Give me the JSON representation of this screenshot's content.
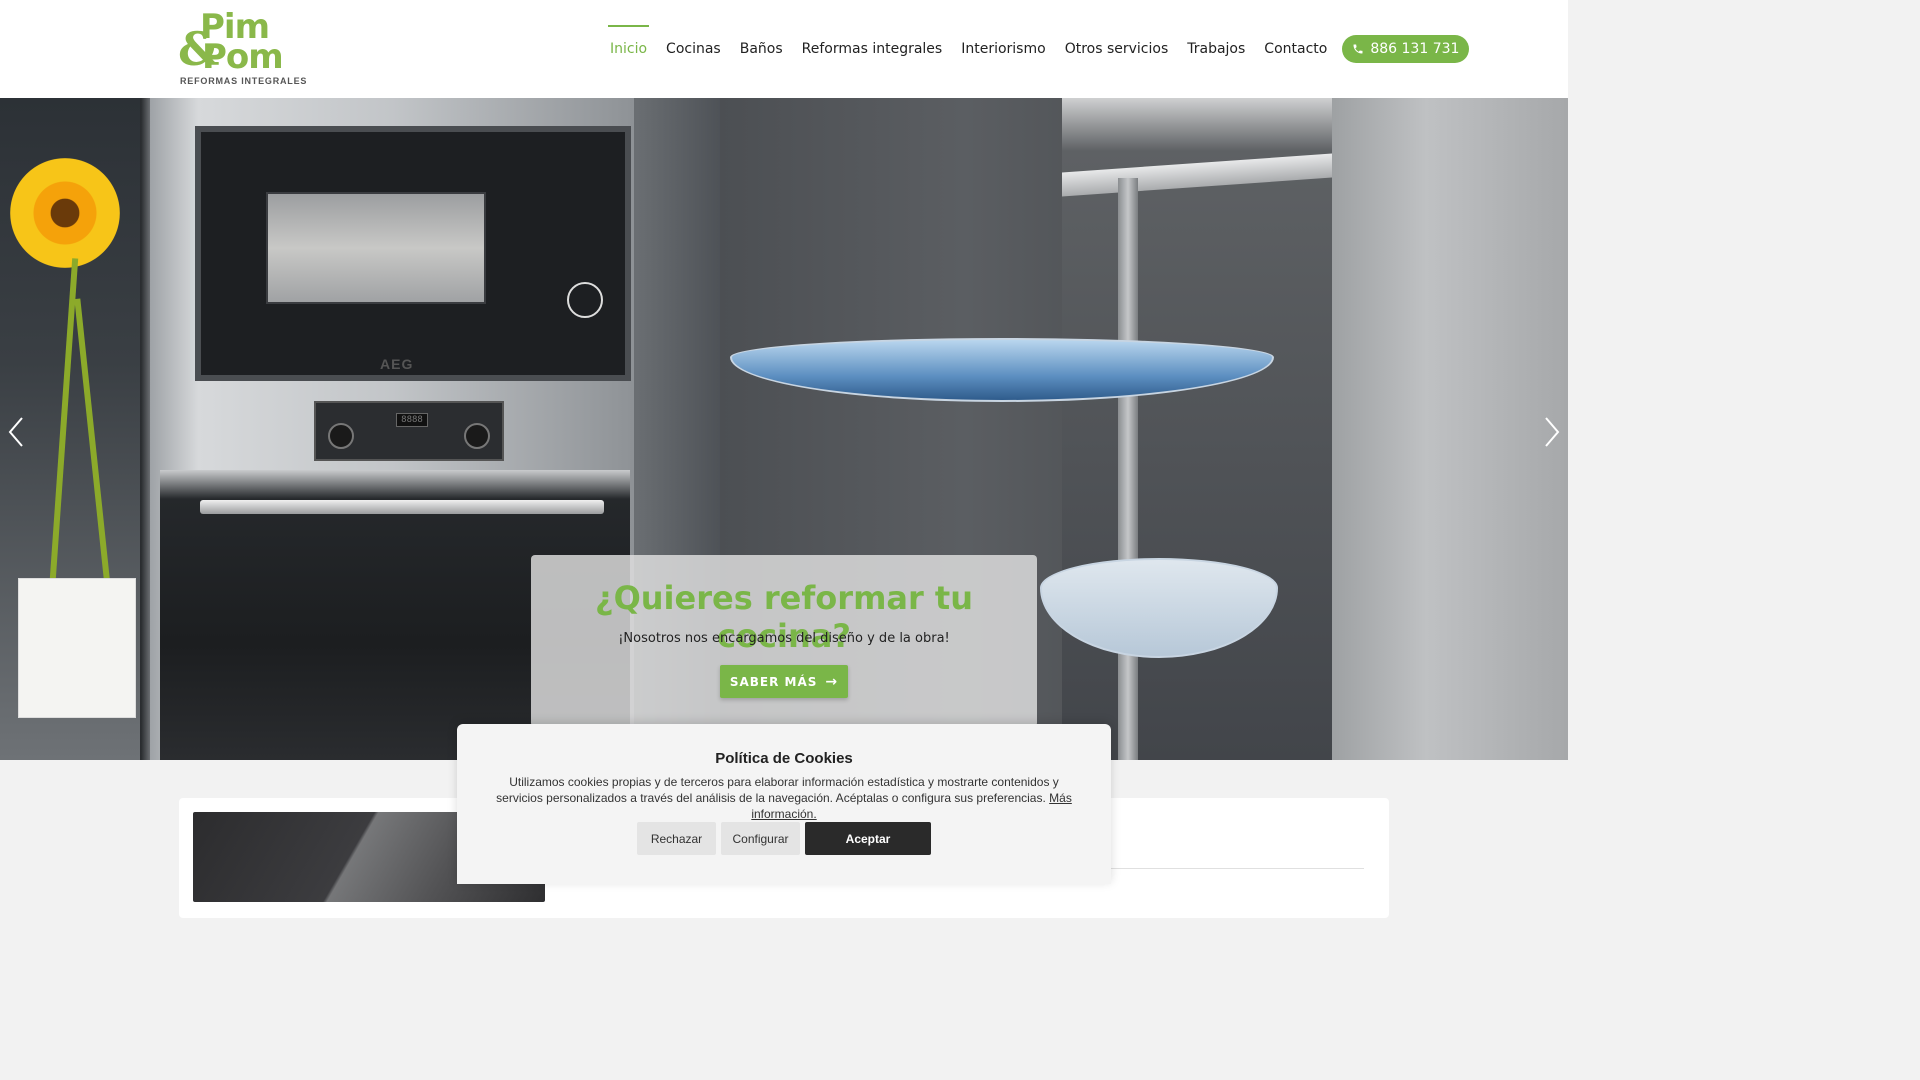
{
  "brand": {
    "name_line1": "Pim",
    "name_line2": "Pom",
    "ampersand": "&",
    "tagline": "REFORMAS INTEGRALES",
    "accent_color": "#7ab648"
  },
  "nav": {
    "items": [
      {
        "label": "Inicio",
        "active": true
      },
      {
        "label": "Cocinas",
        "active": false
      },
      {
        "label": "Baños",
        "active": false
      },
      {
        "label": "Reformas integrales",
        "active": false
      },
      {
        "label": "Interiorismo",
        "active": false
      },
      {
        "label": "Otros servicios",
        "active": false
      },
      {
        "label": "Trabajos",
        "active": false
      },
      {
        "label": "Contacto",
        "active": false
      }
    ],
    "phone": "886 131 731",
    "phone_icon": "phone-icon"
  },
  "hero": {
    "appliance_brand": "AEG",
    "oven_display": "8888",
    "title": "¿Quieres reformar tu cocina?",
    "subtitle": "¡Nosotros nos encargamos del diseño y de la obra!",
    "button_label": "SABER MÁS",
    "button_icon": "arrow-right-icon",
    "prev_icon": "chevron-left-icon",
    "next_icon": "chevron-right-icon"
  },
  "cookies": {
    "title": "Política de Cookies",
    "text": "Utilizamos cookies propias y de terceros para elaborar información estadística y mostrarte contenidos y servicios personalizados a través del análisis de la navegación. Acéptalas o configura sus preferencias.",
    "link_label": "Más información.",
    "reject_label": "Rechazar",
    "configure_label": "Configurar",
    "accept_label": "Aceptar"
  }
}
